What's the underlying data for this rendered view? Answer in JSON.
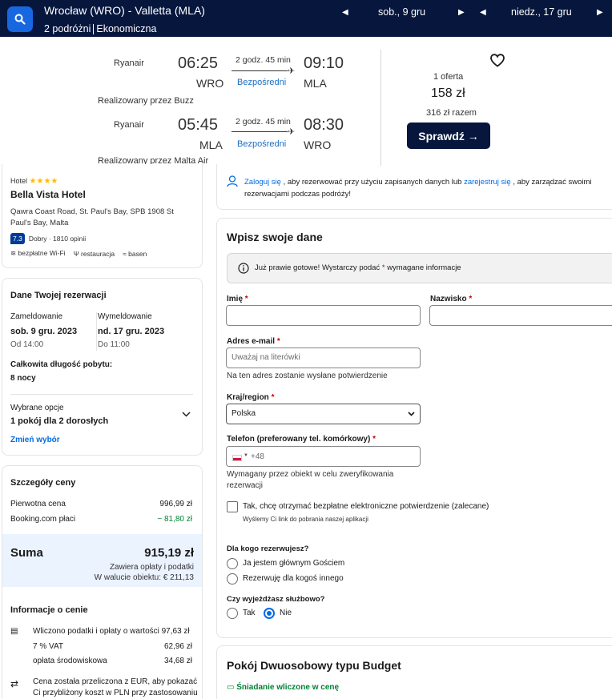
{
  "topbar": {
    "route": "Wrocław (WRO) - Valletta (MLA)",
    "travelers": "2 podróżni",
    "cabin": "Ekonomiczna",
    "depart_date": "sob., 9 gru",
    "return_date": "niedz., 17 gru"
  },
  "flight": {
    "outbound": {
      "airline": "Ryanair",
      "dep_time": "06:25",
      "dep_code": "WRO",
      "duration": "2 godz. 45 min",
      "stops": "Bezpośredni",
      "arr_time": "09:10",
      "arr_code": "MLA",
      "operated_by": "Realizowany przez Buzz"
    },
    "inbound": {
      "airline": "Ryanair",
      "dep_time": "05:45",
      "dep_code": "MLA",
      "duration": "2 godz. 45 min",
      "stops": "Bezpośredni",
      "arr_time": "08:30",
      "arr_code": "WRO",
      "operated_by": "Realizowany przez Malta Air"
    },
    "offers": "1 oferta",
    "price": "158 zł",
    "total": "316 zł razem",
    "check_label": "Sprawdź →"
  },
  "hotel": {
    "type": "Hotel",
    "stars": "★★★★",
    "name": "Bella Vista Hotel",
    "address": "Qawra Coast Road, St. Paul's Bay, SPB 1908 St Paul's Bay, Malta",
    "score": "7.3",
    "rating": "Dobry · 1810 opinii",
    "amenities": [
      "bezpłatne Wi-Fi",
      "restauracja",
      "basen"
    ]
  },
  "booking": {
    "title": "Dane Twojej rezerwacji",
    "checkin_label": "Zameldowanie",
    "checkin_date": "sob. 9 gru. 2023",
    "checkin_time": "Od 14:00",
    "checkout_label": "Wymeldowanie",
    "checkout_date": "nd. 17 gru. 2023",
    "checkout_time": "Do 11:00",
    "length_label": "Całkowita długość pobytu:",
    "length_value": "8 nocy",
    "options_label": "Wybrane opcje",
    "options_value": "1 pokój dla 2 dorosłych",
    "change_link": "Zmień wybór"
  },
  "price": {
    "title": "Szczegóły ceny",
    "original_label": "Pierwotna cena",
    "original_value": "996,99 zł",
    "discount_label": "Booking.com płaci",
    "discount_value": "− 81,80 zł",
    "total_label": "Suma",
    "total_value": "915,19 zł",
    "total_note": "Zawiera opłaty i podatki",
    "local_note": "W walucie obiektu: € 211,13",
    "info_title": "Informacje o cenie",
    "taxes_note": "Wliczono podatki i opłaty o wartości 97,63 zł",
    "vat_label": "7 % VAT",
    "vat_value": "62,96 zł",
    "env_label": "opłata środowiskowa",
    "env_value": "34,68 zł",
    "conversion_note_1": "Cena została przeliczona z EUR, aby pokazać",
    "conversion_note_2": "Ci przybliżony koszt w PLN przy zastosowaniu"
  },
  "login": {
    "login_link": "Zaloguj się",
    "text_1": ", aby rezerwować przy użyciu zapisanych danych lub",
    "register_link": "zarejestruj się",
    "text_2": ", aby zarządzać swoimi",
    "text_3": "rezerwacjami podczas podróży!"
  },
  "form": {
    "title": "Wpisz swoje dane",
    "info_1": "Już prawie gotowe! Wystarczy podać",
    "info_req": "*",
    "info_2": "wymagane informacje",
    "first_name_label": "Imię",
    "last_name_label": "Nazwisko",
    "email_label": "Adres e-mail",
    "email_placeholder": "Uważaj na literówki",
    "email_hint": "Na ten adres zostanie wysłane potwierdzenie",
    "country_label": "Kraj/region",
    "country_value": "Polska",
    "phone_label": "Telefon (preferowany tel. komórkowy)",
    "phone_prefix": "+48",
    "phone_hint_1": "Wymagany przez obiekt w celu zweryfikowania",
    "phone_hint_2": "rezerwacji",
    "confirm_label": "Tak, chcę otrzymać bezpłatne elektroniczne potwierdzenie (zalecane)",
    "confirm_sub": "Wyślemy Ci link do pobrania naszej aplikacji",
    "who_label": "Dla kogo rezerwujesz?",
    "who_opt1": "Ja jestem głównym Gościem",
    "who_opt2": "Rezerwuję dla kogoś innego",
    "business_label": "Czy wyjeżdżasz służbowo?",
    "business_yes": "Tak",
    "business_no": "Nie",
    "required_mark": "*"
  },
  "room": {
    "title": "Pokój Dwuosobowy typu Budget",
    "breakfast": "Śniadanie wliczone w cenę"
  },
  "colors": {
    "nav": "#06163d",
    "accent": "#006ce4",
    "star": "#febb02",
    "green": "#008234"
  }
}
